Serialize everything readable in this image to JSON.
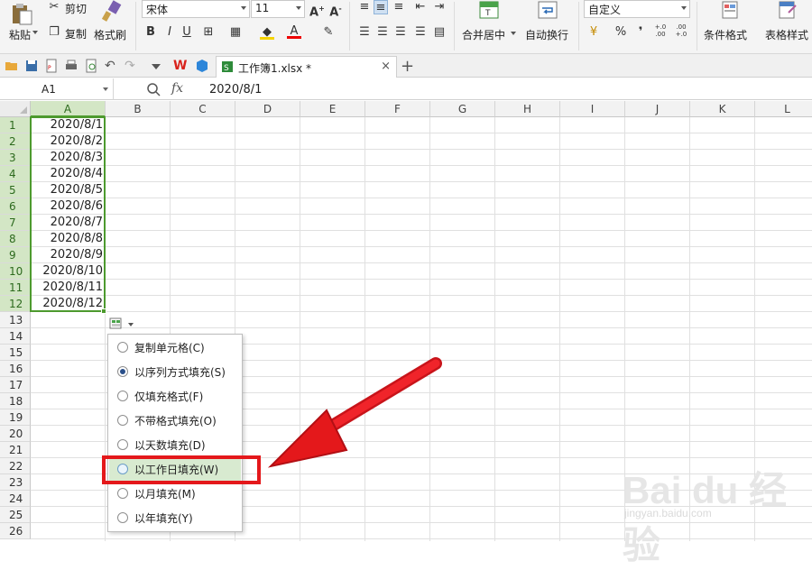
{
  "ribbon": {
    "paste_label": "粘贴",
    "cut_label": "剪切",
    "copy_label": "复制",
    "format_painter_label": "格式刷",
    "font_name": "宋体",
    "font_size": "11",
    "bold": "B",
    "italic": "I",
    "underline": "U",
    "font_color_label": "A",
    "merge_center_label": "合并居中",
    "wrap_text_label": "自动换行",
    "number_format": "自定义",
    "percent": "%",
    "thousands": "❜",
    "dec_inc": "+.0 .00",
    "dec_dec": ".00 +.0",
    "cond_format_label": "条件格式",
    "table_style_label": "表格样式"
  },
  "tab": {
    "file_name": "工作簿1.xlsx *",
    "close": "×",
    "new": "+"
  },
  "formula_bar": {
    "cell_ref": "A1",
    "fx_label": "fx",
    "value": "2020/8/1"
  },
  "grid": {
    "columns": [
      "A",
      "B",
      "C",
      "D",
      "E",
      "F",
      "G",
      "H",
      "I",
      "J",
      "K",
      "L"
    ],
    "rows": [
      "1",
      "2",
      "3",
      "4",
      "5",
      "6",
      "7",
      "8",
      "9",
      "10",
      "11",
      "12",
      "13",
      "14",
      "15",
      "16",
      "17",
      "18",
      "19",
      "20",
      "21",
      "22",
      "23",
      "24",
      "25",
      "26"
    ],
    "cells_a": [
      "2020/8/1",
      "2020/8/2",
      "2020/8/3",
      "2020/8/4",
      "2020/8/5",
      "2020/8/6",
      "2020/8/7",
      "2020/8/8",
      "2020/8/9",
      "2020/8/10",
      "2020/8/11",
      "2020/8/12"
    ]
  },
  "autofill_menu": {
    "options": [
      {
        "label": "复制单元格(C)",
        "checked": false
      },
      {
        "label": "以序列方式填充(S)",
        "checked": true
      },
      {
        "label": "仅填充格式(F)",
        "checked": false
      },
      {
        "label": "不带格式填充(O)",
        "checked": false
      },
      {
        "label": "以天数填充(D)",
        "checked": false
      },
      {
        "label": "以工作日填充(W)",
        "checked": false
      },
      {
        "label": "以月填充(M)",
        "checked": false
      },
      {
        "label": "以年填充(Y)",
        "checked": false
      }
    ]
  },
  "watermark": {
    "brand": "Bai du 经验",
    "site": "jingyan.baidu.com"
  },
  "colors": {
    "selection": "#4d9a2e",
    "header_selected": "#d3e6c5",
    "highlight": "#e4181b"
  }
}
